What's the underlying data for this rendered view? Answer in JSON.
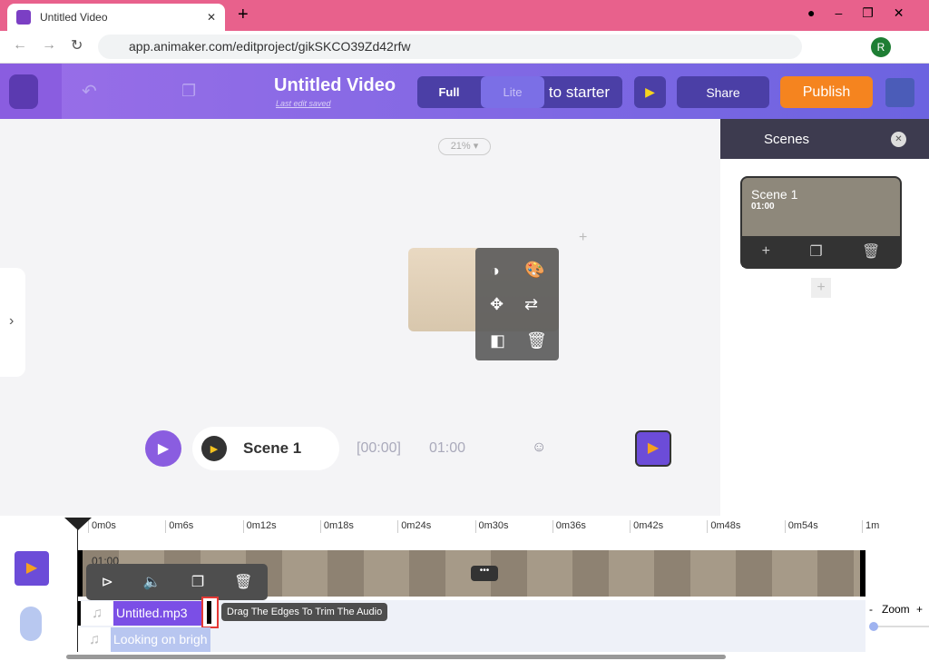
{
  "browser": {
    "tab_title": "Untitled Video",
    "url": "app.animaker.com/editproject/gikSKCO39Zd42rfw",
    "profile_initial": "R"
  },
  "header": {
    "title": "Untitled Video",
    "subtitle": "Last edit saved",
    "mode_full": "Full",
    "mode_lite": "Lite",
    "starter_label": "e to starter",
    "share": "Share",
    "publish": "Publish"
  },
  "canvas": {
    "zoom": "21%",
    "scene_label": "Scene 1",
    "time_current": "[00:00]",
    "time_total": "01:00"
  },
  "scenes": {
    "title": "Scenes",
    "scene_name": "Scene 1",
    "scene_duration": "01:00"
  },
  "timeline": {
    "ticks": [
      "0m0s",
      "0m6s",
      "0m12s",
      "0m18s",
      "0m24s",
      "0m30s",
      "0m36s",
      "0m42s",
      "0m48s",
      "0m54s",
      "1m"
    ],
    "video_duration": "01:00",
    "audio_tracks": [
      "Untitled.mp3",
      "Looking on brigh"
    ],
    "tooltip": "Drag The Edges To Trim The Audio",
    "zoom_label": "Zoom",
    "zoom_minus": "-",
    "zoom_plus": "+"
  },
  "colors": {
    "accent": "#7b5ce6",
    "publish": "#f5841f",
    "tab_bar": "#e8618c"
  }
}
